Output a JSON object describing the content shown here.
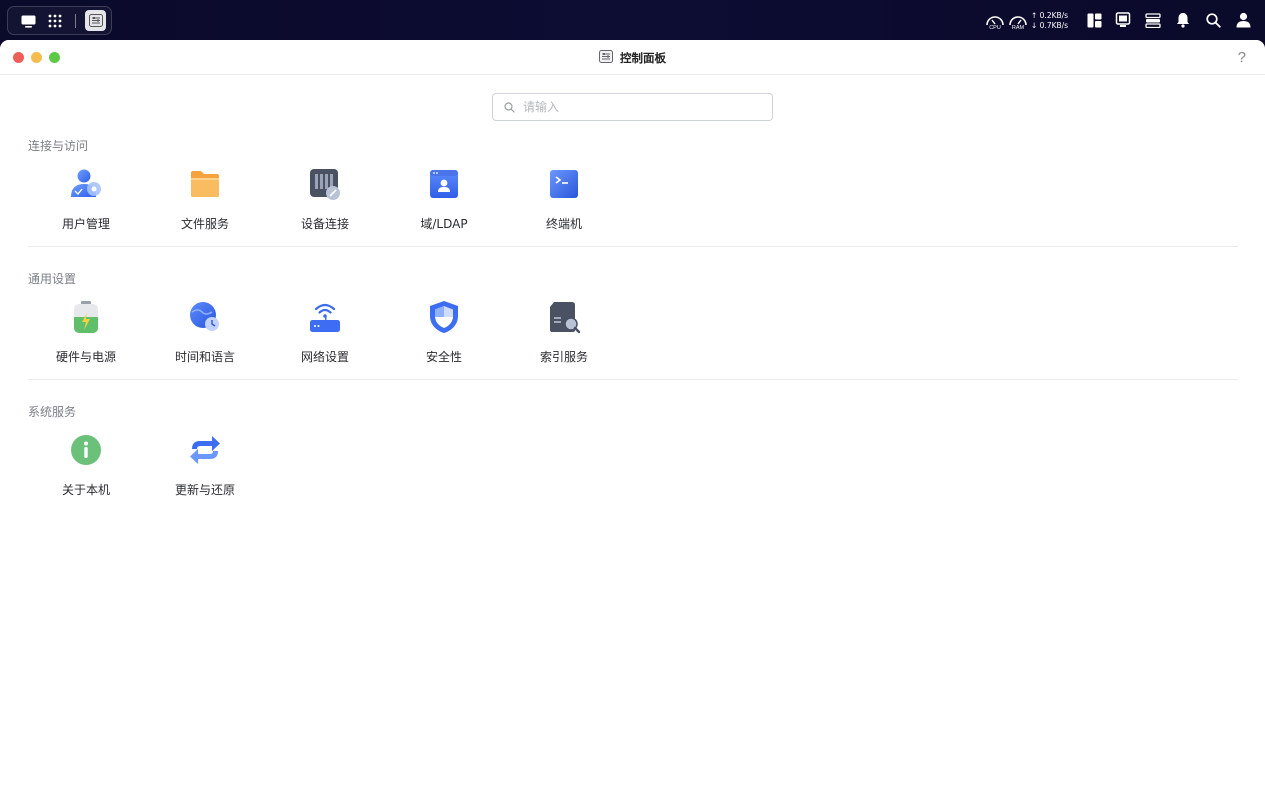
{
  "topbar": {
    "dock": {
      "desktop_icon": "desktop-icon",
      "apps_icon": "grid-icon",
      "active_app_icon": "control-panel-icon"
    },
    "monitor": {
      "cpu_label": "CPU",
      "ram_label": "RAM",
      "upload": "↑ 0.2KB/s",
      "download": "↓ 0.7KB/s"
    },
    "tray_icons": [
      "widgets-icon",
      "display-icon",
      "task-manager-icon",
      "bell-icon",
      "search-icon",
      "user-icon"
    ]
  },
  "window": {
    "title": "控制面板",
    "help_label": "?",
    "search": {
      "placeholder": "请输入",
      "value": ""
    }
  },
  "sections": [
    {
      "title": "连接与访问",
      "items": [
        {
          "label": "用户管理",
          "icon": "user-management-icon"
        },
        {
          "label": "文件服务",
          "icon": "folder-icon"
        },
        {
          "label": "设备连接",
          "icon": "device-connect-icon"
        },
        {
          "label": "域/LDAP",
          "icon": "ldap-icon"
        },
        {
          "label": "终端机",
          "icon": "terminal-icon"
        }
      ]
    },
    {
      "title": "通用设置",
      "items": [
        {
          "label": "硬件与电源",
          "icon": "battery-icon"
        },
        {
          "label": "时间和语言",
          "icon": "globe-clock-icon"
        },
        {
          "label": "网络设置",
          "icon": "router-icon"
        },
        {
          "label": "安全性",
          "icon": "shield-icon"
        },
        {
          "label": "索引服务",
          "icon": "index-search-icon"
        }
      ]
    },
    {
      "title": "系统服务",
      "items": [
        {
          "label": "关于本机",
          "icon": "info-icon"
        },
        {
          "label": "更新与还原",
          "icon": "update-restore-icon"
        }
      ]
    }
  ],
  "colors": {
    "topbar": "#0b0a2b",
    "close": "#ee5f57",
    "minimize": "#f4be4f",
    "maximize": "#5ec847",
    "accent_blue": "#3d6df2"
  }
}
